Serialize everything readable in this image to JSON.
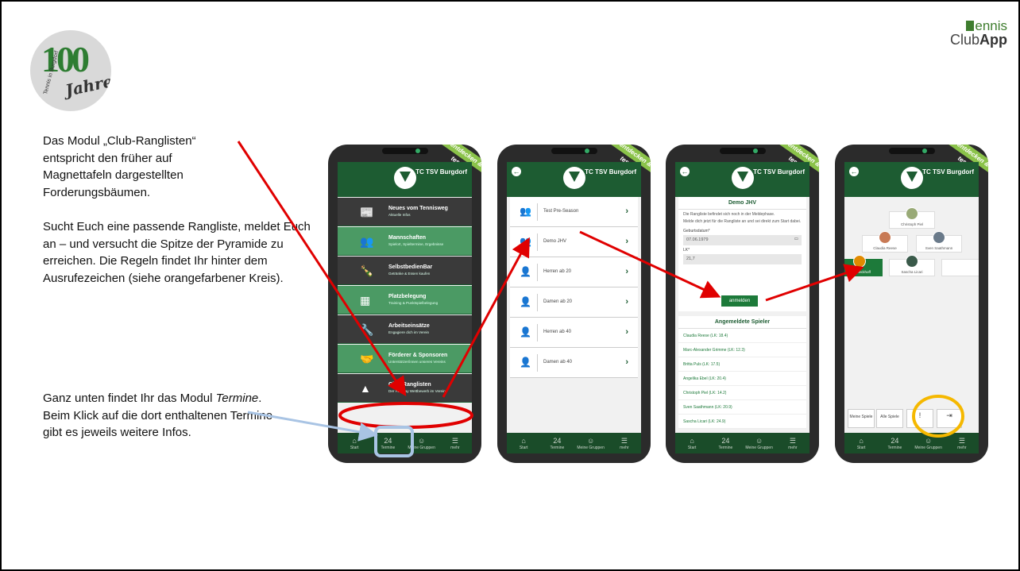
{
  "logo": {
    "big": "100",
    "jahre": "Jahre",
    "side": "Tennis in Burgdorf"
  },
  "brand": {
    "tennis": "ennis",
    "club": "Club",
    "app": "App"
  },
  "description": {
    "p1": "Das Modul „Club-Ranglisten“ entspricht den früher auf Magnettafeln dargestellten Forderungsbäumen.",
    "p2": "Sucht Euch eine passende Rangliste, meldet Euch an – und versucht die Spitze der Pyramide zu erreichen. Die Regeln findet Ihr hinter dem Ausrufezeichen (siehe orangefarbener Kreis).",
    "p3_before": "Ganz unten findet Ihr das Modul ",
    "p3_em": "Termine",
    "p3_after": ". Beim Klick auf die dort enthaltenen Termine gibt es jeweils weitere Infos."
  },
  "club_name": "TC TSV Burgdorf",
  "ribbon": "entdecken & testen!",
  "tabbar": {
    "start": "Start",
    "termine": "Termine",
    "gruppen": "Meine Gruppen",
    "mehr": "mehr",
    "termine_icon": "24"
  },
  "phone1": {
    "modules": [
      {
        "title": "Neues vom Tennisweg",
        "sub": "Aktuelle Infos",
        "icon": "📰"
      },
      {
        "title": "Mannschaften",
        "sub": "Spielort, Spieltermine, Ergebnisse",
        "icon": "👥"
      },
      {
        "title": "SelbstbedienBar",
        "sub": "Getränke & Essen kaufen",
        "icon": "🍾"
      },
      {
        "title": "Platzbelegung",
        "sub": "Training & Punktspielbelegung",
        "icon": "▦"
      },
      {
        "title": "Arbeitseinsätze",
        "sub": "Engagiere dich im Verein",
        "icon": "🔧"
      },
      {
        "title": "Förderer & Sponsoren",
        "sub": "Unterstützer/innen unseres Vereins",
        "icon": "🤝"
      },
      {
        "title": "Club-Ranglisten",
        "sub": "Der FairPlay Wettbewerb im Verein",
        "icon": "▲"
      }
    ]
  },
  "phone2": {
    "lists": [
      {
        "name": "Test Pre-Season",
        "icon": "👥"
      },
      {
        "name": "Demo JHV",
        "icon": "👥"
      },
      {
        "name": "Herren ab 20",
        "icon": "👤"
      },
      {
        "name": "Damen ab 20",
        "icon": "👤"
      },
      {
        "name": "Herren ab 40",
        "icon": "👤"
      },
      {
        "name": "Damen ab 40",
        "icon": "👤"
      }
    ]
  },
  "phone3": {
    "title": "Demo JHV",
    "info1": "Die Rangliste befindet sich noch in der Meldephase.",
    "info2": "Melde dich jetzt für die Rangliste an und sei direkt zum Start dabei.",
    "birth_label": "Geburtsdatum*",
    "birth_value": "07.06.1979",
    "lk_label": "LK*",
    "lk_value": "21,7",
    "button": "anmelden",
    "players_title": "Angemeldete Spieler",
    "players": [
      "Claudia Reese (LK: 18.4)",
      "Marc-Alexander Grimme (LK: 12.3)",
      "Britta Puls (LK: 17.5)",
      "Angelika Ebel (LK: 20.4)",
      "Christoph Piel (LK: 14.2)",
      "Sven Saathmann (LK: 20.9)",
      "Sascha Licari (LK: 24.9)"
    ]
  },
  "phone4": {
    "top": "Christoph Piel",
    "row2": [
      "Claudia Reese",
      "Sven Saathmann"
    ],
    "row3": [
      "Ann Dieckhoff",
      "Sascha Licari"
    ],
    "buttons": {
      "meine": "Meine Spiele",
      "alle": "Alle Spiele",
      "rules_icon": "!",
      "logout_icon": "⇥"
    }
  },
  "colors": {
    "red": "#e00000",
    "orange": "#f5b800",
    "blue": "#a9c4e4",
    "green": "#1d5c32"
  }
}
